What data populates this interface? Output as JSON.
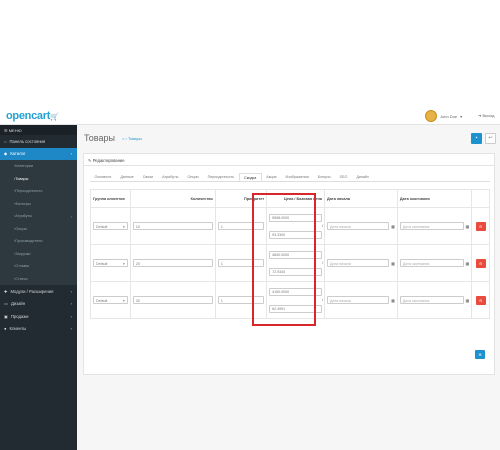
{
  "header": {
    "logo": "opencart",
    "logo_mark": "🛒",
    "user_name": "John Doe",
    "logout": "Выход"
  },
  "sidebar": {
    "menu_label": "МЕНЮ",
    "items": [
      {
        "label": "Панель состояния",
        "icon": "dashboard-icon",
        "active": false
      },
      {
        "label": "Каталог",
        "icon": "tags-icon",
        "active": true
      }
    ],
    "catalog_subitems": [
      {
        "label": "Категории",
        "active": false
      },
      {
        "label": "Товары",
        "active": true
      },
      {
        "label": "Периодичность",
        "active": false
      },
      {
        "label": "Фильтры",
        "active": false
      },
      {
        "label": "Атрибуты",
        "active": false,
        "arrow": "›"
      },
      {
        "label": "Опции",
        "active": false
      },
      {
        "label": "Производители",
        "active": false
      },
      {
        "label": "Загрузки",
        "active": false
      },
      {
        "label": "Отзывы",
        "active": false
      },
      {
        "label": "Статьи",
        "active": false
      }
    ],
    "bottom_items": [
      {
        "label": "Модули / Расширения",
        "icon": "puzzle-icon"
      },
      {
        "label": "Дизайн",
        "icon": "monitor-icon"
      },
      {
        "label": "Продажи",
        "icon": "cart-icon"
      },
      {
        "label": "Клиенты",
        "icon": "user-icon"
      }
    ]
  },
  "page": {
    "title": "Товары",
    "breadcrumb": "Товары",
    "panel_title": "Редактирование",
    "tabs": [
      "Основное",
      "Данные",
      "Связи",
      "Атрибуты",
      "Опции",
      "Периодичность",
      "Скидка",
      "Акция",
      "Изображения",
      "Бонусы",
      "SEO",
      "Дизайн"
    ],
    "active_tab": "Скидка"
  },
  "table": {
    "headers": {
      "group": "Группа клиентов",
      "quantity": "Количество",
      "priority": "Приоритет",
      "price": "Цена / Базовая цена",
      "date_start": "Дата начала",
      "date_end": "Дата окончания"
    },
    "rows": [
      {
        "group": "Default",
        "quantity": "10",
        "priority": "1",
        "price": "5598.0000",
        "base_price": "93.3300",
        "date_start": "Дата начала",
        "date_end": "Дата окончания"
      },
      {
        "group": "Default",
        "quantity": "20",
        "priority": "1",
        "price": "4840.0000",
        "base_price": "72.9340",
        "date_start": "Дата начала",
        "date_end": "Дата окончания"
      },
      {
        "group": "Default",
        "quantity": "30",
        "priority": "1",
        "price": "4150.0000",
        "base_price": "62.4991",
        "date_start": "Дата начала",
        "date_end": "Дата окончания"
      }
    ]
  },
  "colors": {
    "accent": "#1e91cf",
    "danger": "#e94b3c",
    "sidebar": "#222b31",
    "highlight": "#d9262c"
  }
}
